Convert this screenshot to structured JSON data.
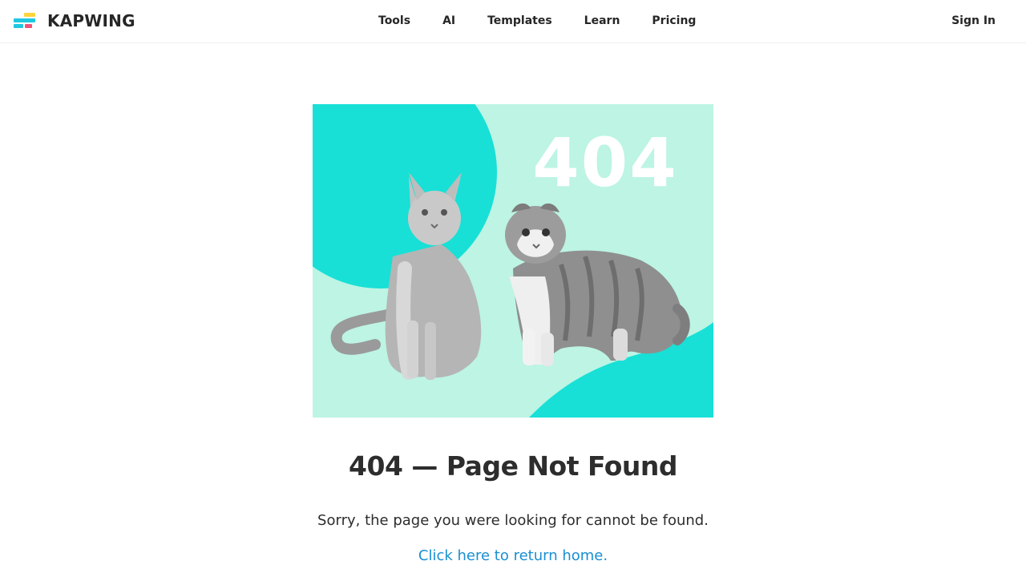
{
  "header": {
    "brand": "KAPWING",
    "nav": [
      {
        "label": "Tools"
      },
      {
        "label": "AI"
      },
      {
        "label": "Templates"
      },
      {
        "label": "Learn"
      },
      {
        "label": "Pricing"
      }
    ],
    "sign_in": "Sign In"
  },
  "hero": {
    "badge_text": "404",
    "icons": [
      "cat-orange",
      "cat-tabby"
    ]
  },
  "main": {
    "title": "404 — Page Not Found",
    "message": "Sorry, the page you were looking for cannot be found.",
    "home_link": "Click here to return home."
  },
  "colors": {
    "teal": "#18e0d6",
    "mint": "#bdf4e4",
    "link": "#1a8fd1",
    "text": "#2d2d2d"
  }
}
